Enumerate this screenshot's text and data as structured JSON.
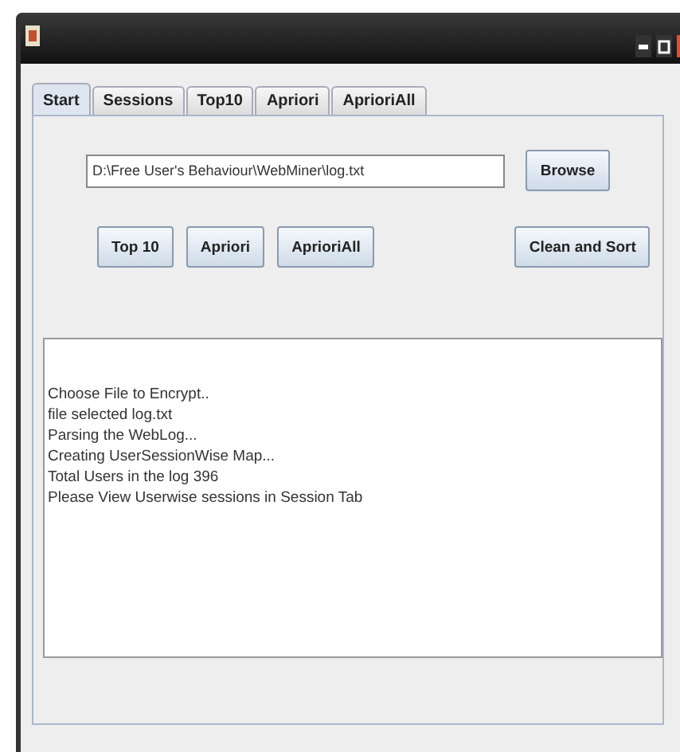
{
  "tabs": [
    {
      "label": "Start",
      "selected": true
    },
    {
      "label": "Sessions",
      "selected": false
    },
    {
      "label": "Top10",
      "selected": false
    },
    {
      "label": "Apriori",
      "selected": false
    },
    {
      "label": "AprioriAll",
      "selected": false
    }
  ],
  "file_field": {
    "value": "D:\\Free User's Behaviour\\WebMiner\\log.txt"
  },
  "browse_button": "Browse",
  "action_buttons": [
    "Top 10",
    "Apriori",
    "AprioriAll"
  ],
  "clean_button": "Clean and Sort",
  "log_lines": [
    "Choose File to Encrypt..",
    "file selected log.txt",
    "Parsing the WebLog...",
    "Creating UserSessionWise Map...",
    "Total Users in the log 396",
    "Please View Userwise sessions in Session Tab"
  ]
}
